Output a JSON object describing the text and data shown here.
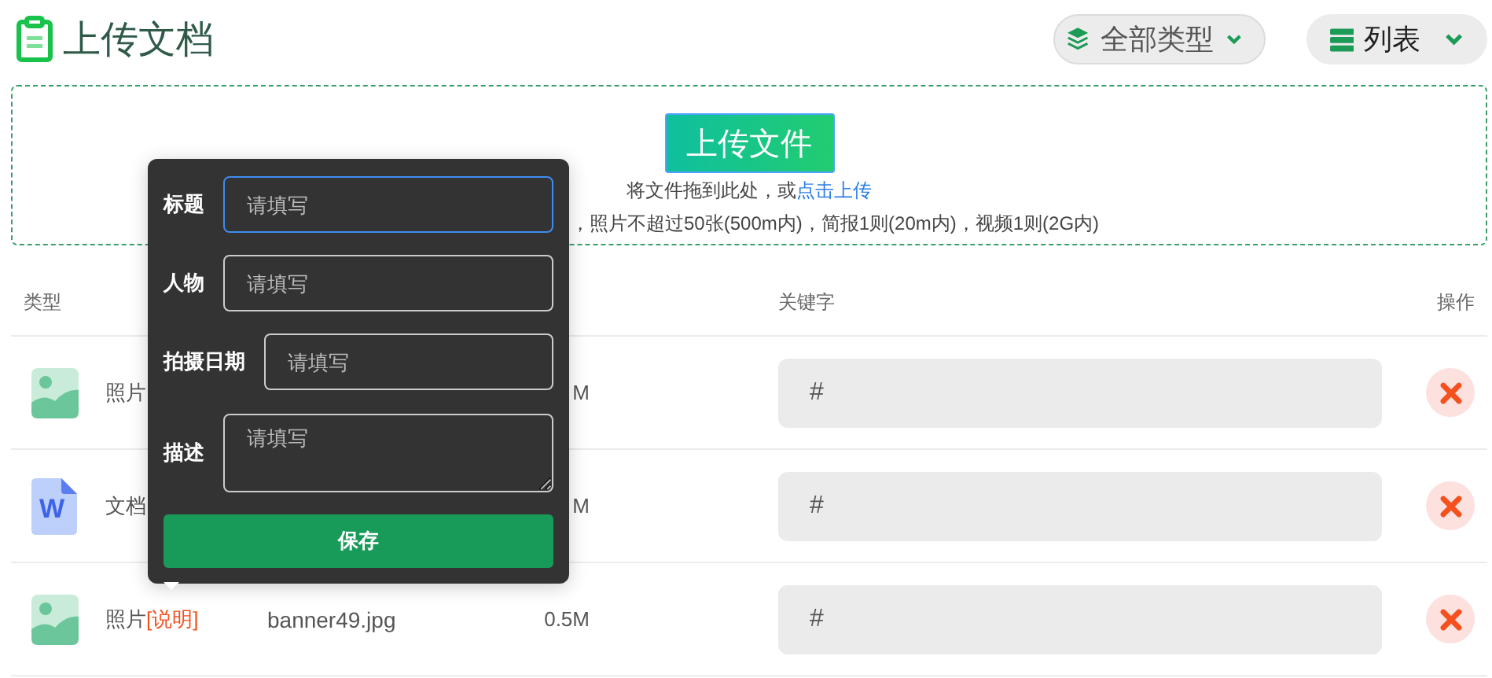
{
  "header": {
    "title": "上传文档",
    "filters": [
      {
        "kind": "type",
        "label": "全部类型"
      },
      {
        "kind": "view",
        "label": "列表"
      }
    ]
  },
  "upload": {
    "button": "上传文件",
    "drop_text": "将文件拖到此处，或",
    "link": "点击上传",
    "hint": "，照片不超过50张(500m内)，简报1则(20m内)，视频1则(2G内)"
  },
  "table": {
    "columns": {
      "type": "类型",
      "keyword": "关键字",
      "action": "操作"
    },
    "rows": [
      {
        "kind": "photo",
        "type": "照片",
        "size": "M",
        "keyword": "#"
      },
      {
        "kind": "document",
        "icon_letter": "W",
        "type": "文档",
        "size": "M",
        "keyword": "#"
      },
      {
        "kind": "photo",
        "type": "照片",
        "note": "[说明]",
        "filename": "banner49.jpg",
        "size": "0.5M",
        "keyword": "#"
      }
    ]
  },
  "popover": {
    "fields": [
      {
        "kind": "input",
        "label": "标题",
        "placeholder": "请填写",
        "focused": true
      },
      {
        "kind": "input",
        "label": "人物",
        "placeholder": "请填写",
        "focused": false
      },
      {
        "kind": "input",
        "label": "拍摄日期",
        "placeholder": "请填写",
        "focused": false
      },
      {
        "kind": "textarea",
        "label": "描述",
        "placeholder": "请填写",
        "focused": false
      }
    ],
    "save": "保存"
  }
}
